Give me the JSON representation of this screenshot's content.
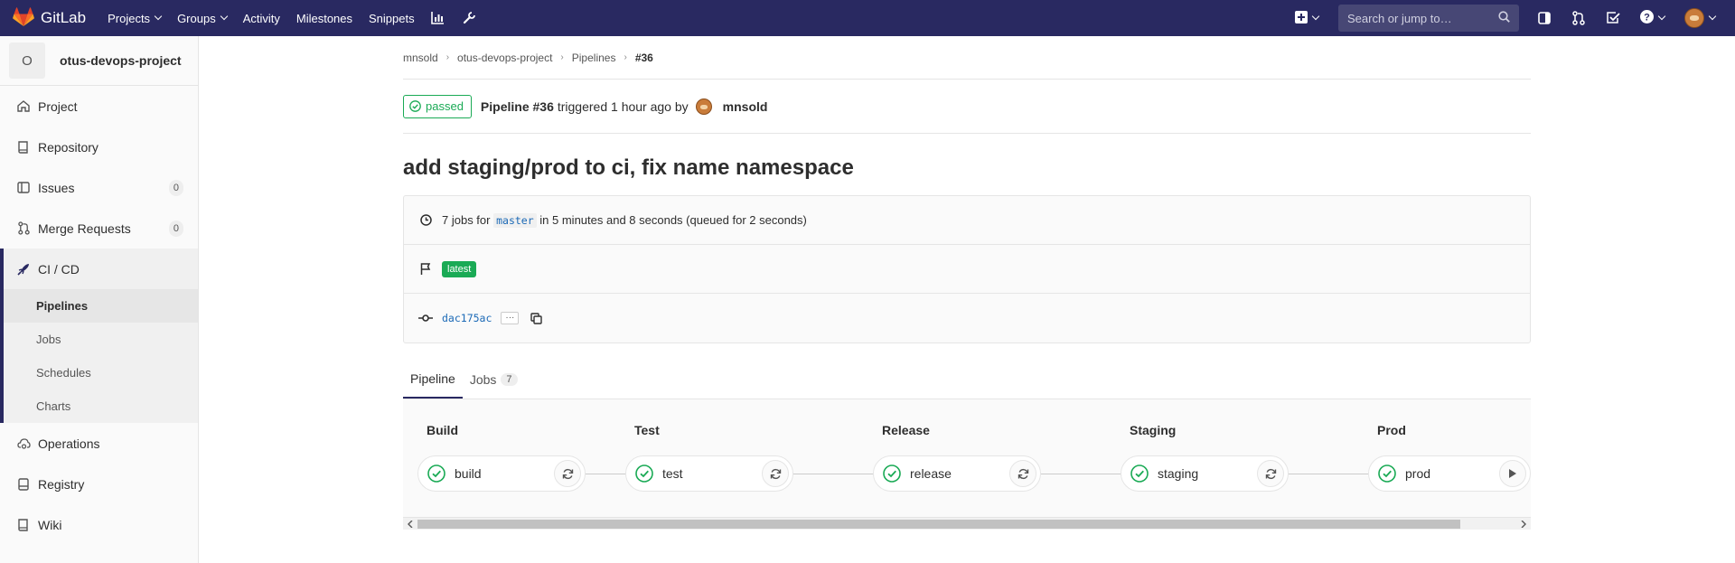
{
  "navbar": {
    "brand": "GitLab",
    "links": [
      {
        "label": "Projects",
        "dropdown": true
      },
      {
        "label": "Groups",
        "dropdown": true
      },
      {
        "label": "Activity",
        "dropdown": false
      },
      {
        "label": "Milestones",
        "dropdown": false
      },
      {
        "label": "Snippets",
        "dropdown": false
      }
    ],
    "search_placeholder": "Search or jump to…",
    "colors": {
      "bg": "#292961",
      "brand_orange": "#e24329"
    }
  },
  "sidebar": {
    "project_initial": "O",
    "project_name": "otus-devops-project",
    "items": [
      {
        "label": "Project",
        "icon": "home-icon"
      },
      {
        "label": "Repository",
        "icon": "book-icon"
      },
      {
        "label": "Issues",
        "icon": "issues-icon",
        "count": "0"
      },
      {
        "label": "Merge Requests",
        "icon": "merge-request-icon",
        "count": "0"
      },
      {
        "label": "CI / CD",
        "icon": "rocket-icon"
      },
      {
        "label": "Operations",
        "icon": "cloud-gear-icon"
      },
      {
        "label": "Registry",
        "icon": "container-icon"
      },
      {
        "label": "Wiki",
        "icon": "book-icon"
      }
    ],
    "cicd_sub": [
      "Pipelines",
      "Jobs",
      "Schedules",
      "Charts"
    ]
  },
  "breadcrumb": [
    "mnsold",
    "otus-devops-project",
    "Pipelines",
    "#36"
  ],
  "pipeline": {
    "status": "passed",
    "label": "Pipeline #36",
    "triggered": "triggered",
    "time": "1 hour ago",
    "by": "by",
    "user": "mnsold",
    "commit_title": "add staging/prod to ci, fix name namespace",
    "jobs_text_1": "7 jobs for",
    "branch": "master",
    "jobs_text_2": "in 5 minutes and 8 seconds (queued for 2 seconds)",
    "badge": "latest",
    "sha": "dac175ac",
    "ellipsis": "···"
  },
  "tabs": [
    {
      "label": "Pipeline",
      "active": true
    },
    {
      "label": "Jobs",
      "count": "7"
    }
  ],
  "stages": [
    {
      "title": "Build",
      "job": "build"
    },
    {
      "title": "Test",
      "job": "test"
    },
    {
      "title": "Release",
      "job": "release"
    },
    {
      "title": "Staging",
      "job": "staging"
    },
    {
      "title": "Prod",
      "job": "prod"
    }
  ],
  "colors": {
    "success": "#1aaa55",
    "link": "#1b69b6",
    "accent": "#292961"
  }
}
